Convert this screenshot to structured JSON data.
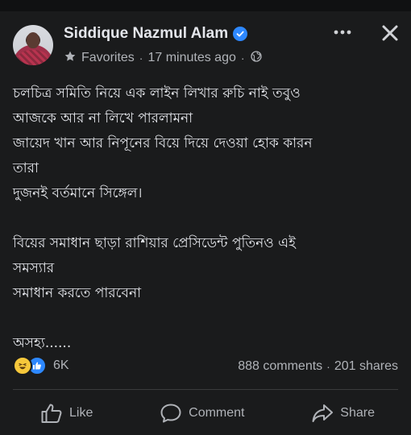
{
  "post": {
    "author": "Siddique Nazmul Alam",
    "audience": "Favorites",
    "separator": "·",
    "time": "17 minutes ago",
    "text_lines": [
      "চলচিত্র সমিতি নিয়ে এক লাইন লিখার রুচি নাই তবুও",
      "আজকে আর না লিখে পারলামনা",
      "জায়েদ খান আর নিপূনের বিয়ে দিয়ে দেওয়া হোক কারন",
      "তারা",
      "দুজনই বর্তমানে সিঙ্গেল।",
      "বিয়ের সমাধান ছাড়া রাশিয়ার প্রেসিডেন্ট পুতিনও এই",
      "সমস্যার",
      "সমাধান করতে পারবেনা",
      "অসহ্য......"
    ],
    "reaction_count": "6K",
    "comments": "888 comments",
    "shares": "201 shares"
  },
  "actions": {
    "like": "Like",
    "comment": "Comment",
    "share": "Share"
  },
  "colors": {
    "background": "#1a1b1c",
    "text": "#e4e6eb",
    "secondary_text": "#b0b3b8",
    "verified": "#2d88ff"
  },
  "icons": {
    "verified": "verified-badge-icon",
    "audience": "star-icon",
    "privacy": "globe-icon",
    "more": "more-icon",
    "close": "close-icon",
    "reaction_haha": "haha-reaction-icon",
    "reaction_like": "like-reaction-icon",
    "like": "thumbs-up-icon",
    "comment": "comment-icon",
    "share": "share-icon"
  }
}
